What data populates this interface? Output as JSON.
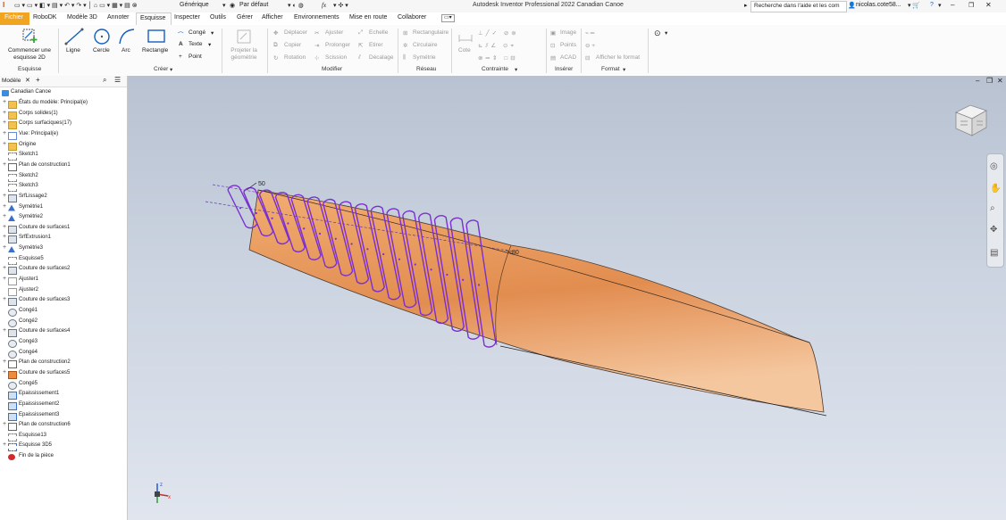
{
  "titlebar": {
    "preset": "Générique",
    "appearance": "Par défaut",
    "fx": "fx",
    "app_title": "Autodesk Inventor Professional 2022   Canadian Canoe",
    "help_search": "Recherche dans l'aide et les com",
    "user": "nicolas.cote58..."
  },
  "tabs": [
    "Fichier",
    "RoboDK",
    "Modèle 3D",
    "Annoter",
    "Esquisse",
    "Inspecter",
    "Outils",
    "Gérer",
    "Afficher",
    "Environnements",
    "Mise en route",
    "Collaborer"
  ],
  "ribbon": {
    "esquisse": {
      "label": "Commencer une esquisse 2D",
      "group": "Esquisse"
    },
    "creer": {
      "ligne": "Ligne",
      "cercle": "Cercle",
      "arc": "Arc",
      "rectangle": "Rectangle",
      "conge": "Congé",
      "texte": "Texte",
      "point": "Point",
      "group": "Créer"
    },
    "projeter": "Projeter la géométrie",
    "modifier": {
      "deplacer": "Déplacer",
      "copier": "Copier",
      "rotation": "Rotation",
      "ajuster": "Ajuster",
      "prolonger": "Prolonger",
      "scission": "Scission",
      "echelle": "Echelle",
      "etirer": "Etirer",
      "decalage": "Décalage",
      "group": "Modifier"
    },
    "reseau": {
      "rect": "Rectangulaire",
      "circ": "Circulaire",
      "sym": "Symétrie",
      "group": "Réseau"
    },
    "contrainte": {
      "cote": "Cote",
      "group": "Contrainte"
    },
    "inserer": {
      "image": "Image",
      "points": "Points",
      "acad": "ACAD",
      "group": "Insérer"
    },
    "format": {
      "afficher": "Afficher le format",
      "group": "Format"
    }
  },
  "browser": {
    "tab_label": "Modèle",
    "root": "Canadian Canoe",
    "items": [
      {
        "label": "États du modèle: Principal(e)",
        "plus": true,
        "icon": "folder"
      },
      {
        "label": "Corps solides(1)",
        "plus": true,
        "icon": "folder"
      },
      {
        "label": "Corps surfaciques(17)",
        "plus": true,
        "icon": "folder"
      },
      {
        "label": "Vue: Principal(e)",
        "plus": true,
        "icon": "view"
      },
      {
        "label": "Origine",
        "plus": true,
        "icon": "folder"
      },
      {
        "label": "Sketch1",
        "plus": false,
        "icon": "sketch"
      },
      {
        "label": "Plan de construction1",
        "plus": true,
        "icon": "plane"
      },
      {
        "label": "Sketch2",
        "plus": false,
        "icon": "sketch"
      },
      {
        "label": "Sketch3",
        "plus": false,
        "icon": "sketch"
      },
      {
        "label": "SrfLissage2",
        "plus": true,
        "icon": "surface"
      },
      {
        "label": "Symétrie1",
        "plus": true,
        "icon": "mirror"
      },
      {
        "label": "Symétrie2",
        "plus": true,
        "icon": "mirror"
      },
      {
        "label": "Couture de surfaces1",
        "plus": true,
        "icon": "surface"
      },
      {
        "label": "SrfExtrusion1",
        "plus": true,
        "icon": "surface"
      },
      {
        "label": "Symétrie3",
        "plus": true,
        "icon": "mirror"
      },
      {
        "label": "Esquisse5",
        "plus": false,
        "icon": "sketch"
      },
      {
        "label": "Couture de surfaces2",
        "plus": true,
        "icon": "surface"
      },
      {
        "label": "Ajuster1",
        "plus": true,
        "icon": "trim"
      },
      {
        "label": "Ajuster2",
        "plus": false,
        "icon": "trim"
      },
      {
        "label": "Couture de surfaces3",
        "plus": true,
        "icon": "surface"
      },
      {
        "label": "Congé1",
        "plus": false,
        "icon": "fillet"
      },
      {
        "label": "Congé2",
        "plus": false,
        "icon": "fillet"
      },
      {
        "label": "Couture de surfaces4",
        "plus": true,
        "icon": "surface"
      },
      {
        "label": "Congé3",
        "plus": false,
        "icon": "fillet"
      },
      {
        "label": "Congé4",
        "plus": false,
        "icon": "fillet"
      },
      {
        "label": "Plan de construction2",
        "plus": true,
        "icon": "plane"
      },
      {
        "label": "Couture de surfaces5",
        "plus": true,
        "icon": "surface-orange"
      },
      {
        "label": "Congé5",
        "plus": false,
        "icon": "fillet"
      },
      {
        "label": "Epaississement1",
        "plus": false,
        "icon": "thicken"
      },
      {
        "label": "Epaississement2",
        "plus": false,
        "icon": "thicken"
      },
      {
        "label": "Epaississement3",
        "plus": false,
        "icon": "thicken"
      },
      {
        "label": "Plan de construction6",
        "plus": true,
        "icon": "plane"
      },
      {
        "label": "Esquisse13",
        "plus": false,
        "icon": "sketch"
      },
      {
        "label": "Esquisse 3D5",
        "plus": true,
        "icon": "sketch3d"
      },
      {
        "label": "Fin de la pièce",
        "plus": false,
        "icon": "end"
      }
    ]
  },
  "viewport": {
    "dim_left": "50",
    "dim_right": "80"
  },
  "colors": {
    "accent": "#1560bd",
    "file_tab": "#f0a41f",
    "canoe": "#e39156",
    "sketch": "#7b2fd0"
  }
}
